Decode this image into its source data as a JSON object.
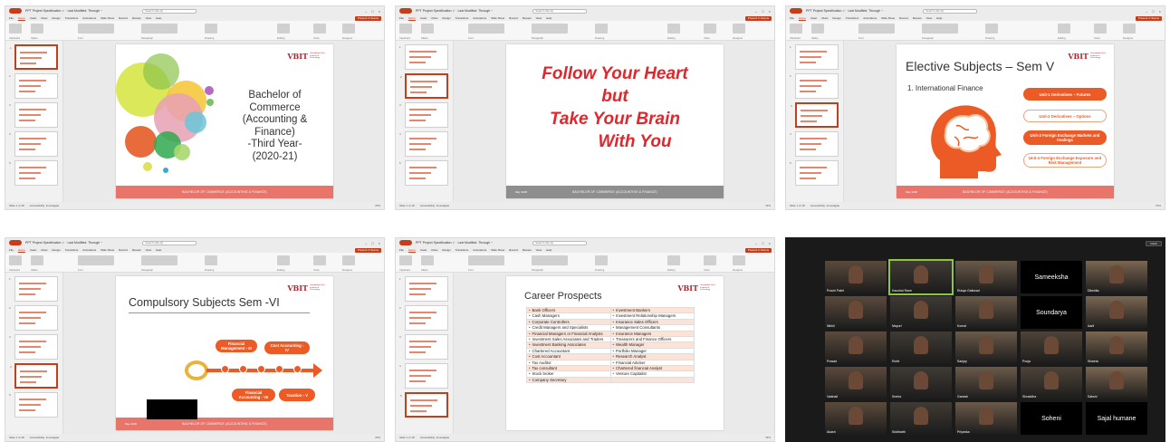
{
  "ppt": {
    "window_title": "PPT Project Specification ✓ · Last Modified: Through ~",
    "autosave": "AutoSave",
    "search_placeholder": "Search (Alt+Q)",
    "menus": [
      "File",
      "Home",
      "Insert",
      "Draw",
      "Design",
      "Transitions",
      "Animations",
      "Slide Show",
      "Record",
      "Review",
      "View",
      "Help"
    ],
    "present": "Present in Teams",
    "ribbon_groups": [
      "Clipboard",
      "Slides",
      "Font",
      "Paragraph",
      "Drawing",
      "Editing",
      "Voice",
      "Designer"
    ],
    "status": "Slide 1 of 18",
    "accessibility": "Accessibility: Investigate",
    "zoom": "79%"
  },
  "slide1": {
    "title_lines": [
      "Bachelor of Commerce",
      "(Accounting & Finance)",
      "-Third Year-",
      "(2020-21)"
    ],
    "footer": "BACHELOR OF COMMERCE (ACCOUNTING & FINANCE)"
  },
  "slide2": {
    "quote_lines": [
      "Follow Your Heart",
      "but",
      "Take Your Brain",
      "With You"
    ],
    "footer": "BACHELOR OF COMMERCE (ACCOUNTING & FINANCE)",
    "date": "May 2020",
    "thumb_quote": [
      "Follow Your Heart",
      "but",
      "Take Your Brain",
      "With You"
    ]
  },
  "slide3": {
    "title": "Elective Subjects – Sem V",
    "item": "1. International Finance",
    "units": [
      {
        "text": "Unit-1 Derivatives – Futures",
        "style": "solid"
      },
      {
        "text": "Unit-2 Derivatives – Options",
        "style": "outline"
      },
      {
        "text": "Unit-3 Foreign Exchange Markets and Dealings",
        "style": "solid"
      },
      {
        "text": "Unit-4 Foreign Exchange Exposure and Risk Management",
        "style": "outline"
      }
    ],
    "footer": "BACHELOR OF COMMERCE (ACCOUNTING & FINANCE)",
    "date": "May 2020"
  },
  "slide4": {
    "title": "Compulsory Subjects  Sem -VI",
    "badges": [
      "Financial Management - III",
      "Cost Accounting - IV",
      "Financial Accounting - VII",
      "Taxation - V"
    ],
    "teeth": [
      "01",
      "02",
      "03",
      "04",
      "05"
    ],
    "footer": "BACHELOR OF COMMERCE (ACCOUNTING & FINANCE)",
    "date": "May 2020"
  },
  "slide5": {
    "title": "Career  Prospects",
    "rows": [
      [
        "Bank Officers",
        "Investment Bankers"
      ],
      [
        "Cash Managers",
        "Investment Relationship Managers"
      ],
      [
        "Corporate Controllers",
        "Insurance Sales Officers"
      ],
      [
        "Credit Managers and Specialists",
        "Management Consultants"
      ],
      [
        "Financial Managers or Financial Analysts",
        "Insurance Managers"
      ],
      [
        "Investment Sales Associates and Traders",
        "Treasurers and Finance Officers"
      ],
      [
        "Investment Banking Associates",
        "Wealth Manager"
      ],
      [
        "Chartered Accountant",
        "Portfolio Manager"
      ],
      [
        "Cost Accountant",
        "Research Analyst"
      ],
      [
        "Tax Auditor",
        "Financial Adviser"
      ],
      [
        "Tax consultant",
        "Chartered financial Analyst"
      ],
      [
        "Stock broker",
        "Venture Capitalist"
      ],
      [
        "Company Secretary",
        ""
      ]
    ]
  },
  "vbit": {
    "mark": "VBIT",
    "sub": "Vasantdada Patil Institute of Technology"
  },
  "zoom": {
    "view_label": "VIEW",
    "participants": [
      {
        "name": "Prachi Patel",
        "row": 0,
        "col": 0,
        "video": true
      },
      {
        "name": "Kaushal Rane",
        "row": 0,
        "col": 1,
        "video": true,
        "active": true
      },
      {
        "name": "Rutuja Gaikwad",
        "row": 0,
        "col": 2,
        "video": true
      },
      {
        "name": "Sameeksha",
        "row": 0,
        "col": 3,
        "video": false
      },
      {
        "name": "Dikshita",
        "row": 0,
        "col": 4,
        "video": true
      },
      {
        "name": "Nikhil",
        "row": 1,
        "col": 0,
        "video": true
      },
      {
        "name": "Mayuri",
        "row": 1,
        "col": 1,
        "video": true
      },
      {
        "name": "Komal",
        "row": 1,
        "col": 2,
        "video": true
      },
      {
        "name": "Soundarya",
        "row": 1,
        "col": 3,
        "video": false
      },
      {
        "name": "Aarti",
        "row": 1,
        "col": 4,
        "video": true
      },
      {
        "name": "Prasad",
        "row": 2,
        "col": 0,
        "video": true
      },
      {
        "name": "Rohit",
        "row": 2,
        "col": 1,
        "video": true
      },
      {
        "name": "Sanjay",
        "row": 2,
        "col": 2,
        "video": true
      },
      {
        "name": "Pooja",
        "row": 2,
        "col": 3,
        "video": true
      },
      {
        "name": "Shweta",
        "row": 2,
        "col": 4,
        "video": true
      },
      {
        "name": "Vaishali",
        "row": 3,
        "col": 0,
        "video": true
      },
      {
        "name": "Sneha",
        "row": 3,
        "col": 1,
        "video": true
      },
      {
        "name": "Ganesh",
        "row": 3,
        "col": 2,
        "video": true
      },
      {
        "name": "Shraddha",
        "row": 3,
        "col": 3,
        "video": true
      },
      {
        "name": "Sakshi",
        "row": 3,
        "col": 4,
        "video": true
      },
      {
        "name": "Akash",
        "row": 4,
        "col": 0,
        "video": true
      },
      {
        "name": "Siddharth",
        "row": 4,
        "col": 1,
        "video": true
      },
      {
        "name": "Priyanka",
        "row": 4,
        "col": 2,
        "video": true
      },
      {
        "name": "Soheni",
        "row": 4,
        "col": 3,
        "video": false
      },
      {
        "name": "Sajal humane",
        "row": 4,
        "col": 4,
        "video": false
      }
    ]
  }
}
